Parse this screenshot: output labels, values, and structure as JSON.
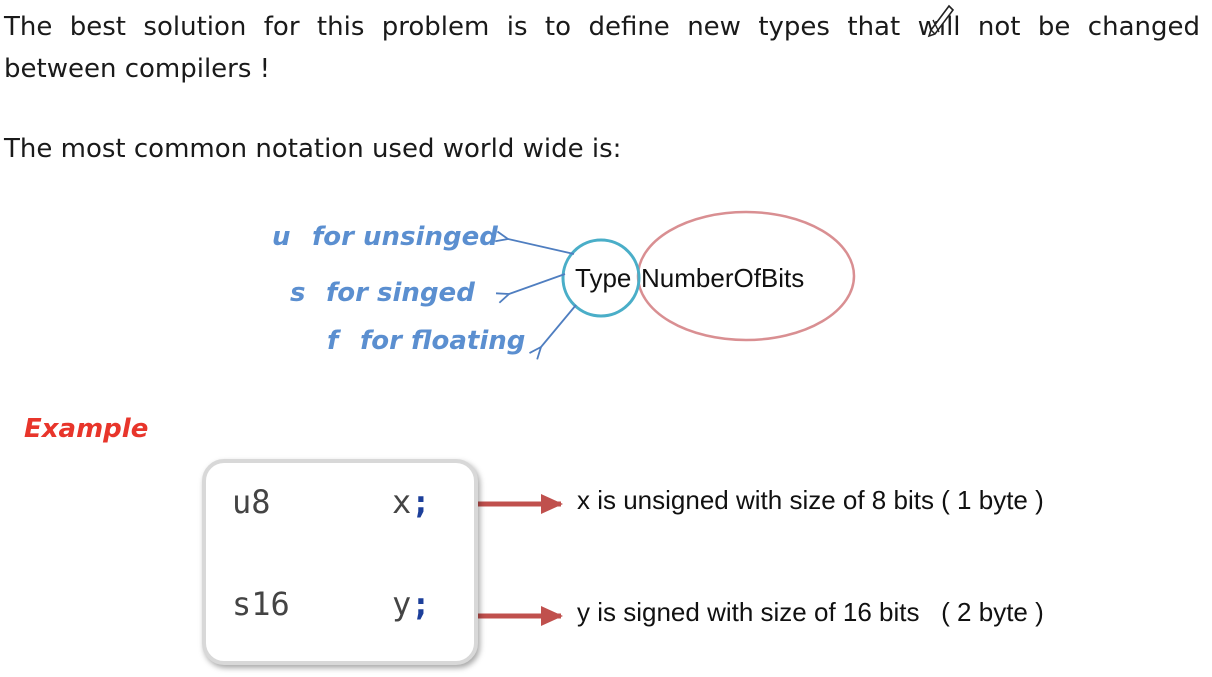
{
  "intro": {
    "line1": "The best solution for this problem is to define new types that will not be changed",
    "line2": "between compilers !",
    "notation": "The most common notation used world wide is:"
  },
  "diagram": {
    "type_part": "Type",
    "bits_part": "NumberOfBits",
    "legend": [
      {
        "letter": "u",
        "text": "for unsinged"
      },
      {
        "letter": "s",
        "text": "for singed"
      },
      {
        "letter": "f",
        "text": "for floating"
      }
    ],
    "colors": {
      "legend_text": "#5b8fd0",
      "type_circle": "#4aaec8",
      "bits_ellipse": "#d98f92",
      "arrow_red": "#c0504d"
    }
  },
  "example": {
    "label": "Example",
    "label_color": "#e8352b",
    "rows": [
      {
        "type": "u8",
        "var": "x",
        "semicolon": ";",
        "description": "x is unsigned with size of 8 bits ( 1 byte )"
      },
      {
        "type": "s16",
        "var": "y",
        "semicolon": ";",
        "description": "y is signed with size of 16 bits   ( 2 byte )"
      }
    ]
  },
  "icons": {
    "cursor": "pen-cursor-icon"
  }
}
